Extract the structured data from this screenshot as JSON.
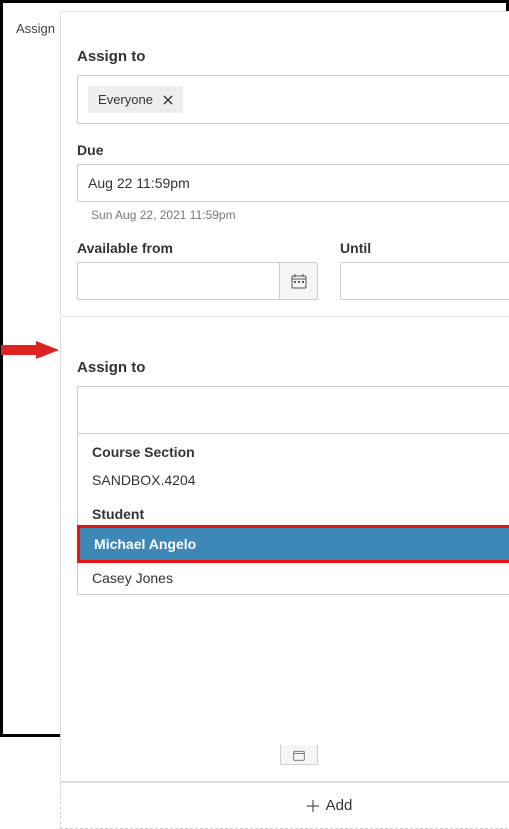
{
  "leftLabel": "Assign",
  "card1": {
    "assignTitle": "Assign to",
    "chipLabel": "Everyone",
    "dueLabel": "Due",
    "dueValue": "Aug 22 11:59pm",
    "dueHelper": "Sun Aug 22, 2021 11:59pm",
    "availLabel": "Available from",
    "untilLabel": "Until",
    "availValue": "",
    "untilValue": ""
  },
  "card2": {
    "assignTitle": "Assign to",
    "dropdown": {
      "groupSection": "Course Section",
      "section1": "SANDBOX.4204",
      "groupStudent": "Student",
      "student1": "Michael Angelo",
      "student2": "Casey Jones"
    }
  },
  "addLabel": "Add"
}
